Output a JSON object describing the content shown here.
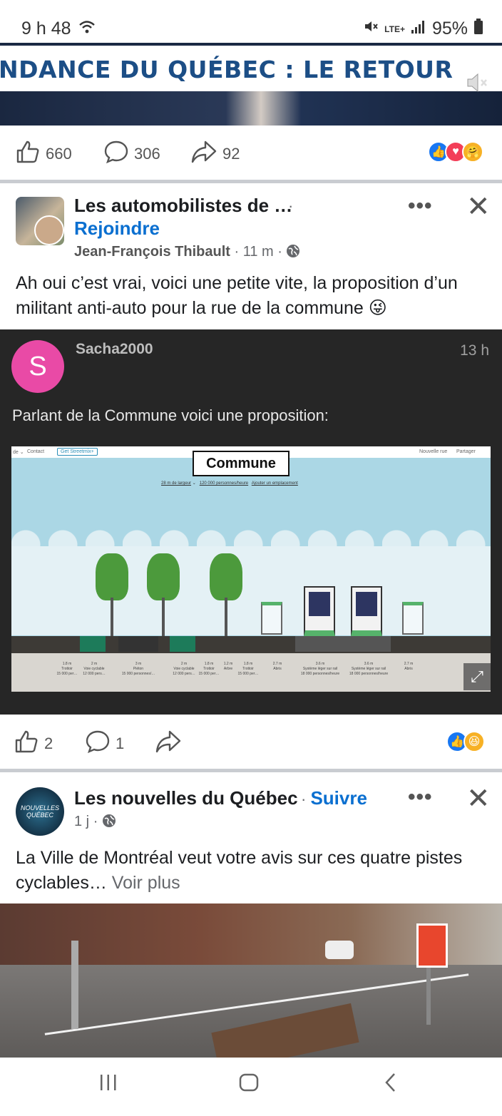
{
  "status": {
    "time": "9 h 48",
    "network": "LTE+",
    "battery": "95%"
  },
  "video": {
    "banner": "NDANCE DU QUÉBEC : LE RETOUR"
  },
  "post1_reactions": {
    "likes": "660",
    "comments": "306",
    "shares": "92"
  },
  "post2": {
    "group_name": "Les automobilistes de …",
    "join_label": "Rejoindre",
    "author": "Jean-François Thibault",
    "time": "11 m",
    "text": "Ah oui c’est vrai, voici une petite vite, la proposition d’un militant anti-auto pour la rue de la commune 😜",
    "shared": {
      "avatar_letter": "S",
      "author": "Sacha2000",
      "time": "13 h",
      "text": "Parlant de la Commune voici une proposition:",
      "street": {
        "title": "Commune",
        "width": "28 m de largeur",
        "capacity": "120 000 personnes/heure",
        "add_location": "Ajouter un emplacement",
        "menu_contact": "Contact",
        "menu_get": "Get Streetmix+",
        "menu_new": "Nouvelle rue",
        "menu_share": "Partager"
      }
    },
    "reactions": {
      "likes": "2",
      "comments": "1"
    }
  },
  "post3": {
    "page_name": "Les nouvelles du Québec",
    "follow_label": "Suivre",
    "time": "1 j",
    "text": "La Ville de Montréal veut votre avis sur ces quatre pistes cyclables…",
    "see_more": "Voir plus"
  },
  "icons": {
    "like": "thumbs-up-icon",
    "comment": "comment-bubble-icon",
    "share": "share-arrow-icon",
    "globe": "globe-icon",
    "more": "more-dots-icon",
    "close": "close-icon"
  }
}
